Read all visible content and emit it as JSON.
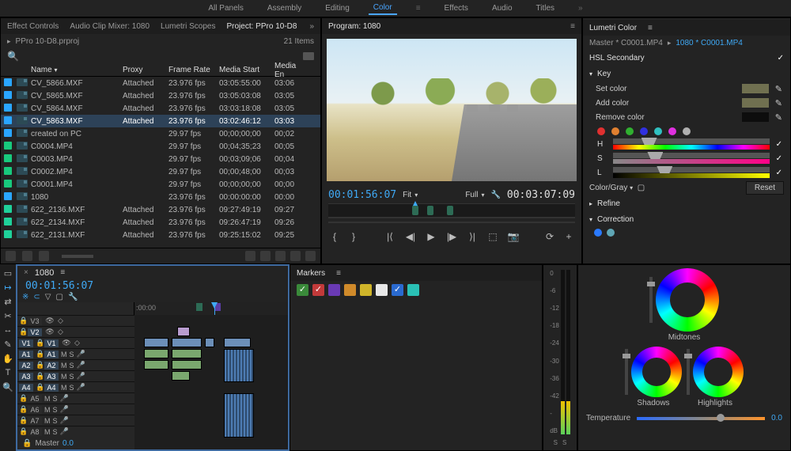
{
  "workspaces": {
    "w1": "All Panels",
    "w2": "Assembly",
    "w3": "Editing",
    "w4": "Color",
    "w5": "Effects",
    "w6": "Audio",
    "w7": "Titles"
  },
  "project_tabs": {
    "t1": "Effect Controls",
    "t2": "Audio Clip Mixer: 1080",
    "t3": "Lumetri Scopes",
    "t4": "Project: PPro 10-D8"
  },
  "project": {
    "path_file": "PPro 10-D8.prproj",
    "items_count": "21 Items",
    "headers": {
      "name": "Name",
      "proxy": "Proxy",
      "frame": "Frame Rate",
      "start": "Media Start",
      "end": "Media En"
    },
    "rows": [
      {
        "chip": "chipc1",
        "name": "CV_5866.MXF",
        "proxy": "Attached",
        "fr": "23.976 fps",
        "start": "03:05:55:00",
        "end": "03:06"
      },
      {
        "chip": "chipc1",
        "name": "CV_5865.MXF",
        "proxy": "Attached",
        "fr": "23.976 fps",
        "start": "03:05:03:08",
        "end": "03:05"
      },
      {
        "chip": "chipc1",
        "name": "CV_5864.MXF",
        "proxy": "Attached",
        "fr": "23.976 fps",
        "start": "03:03:18:08",
        "end": "03:05"
      },
      {
        "chip": "chipc1",
        "name": "CV_5863.MXF",
        "proxy": "Attached",
        "fr": "23.976 fps",
        "start": "03:02:46:12",
        "end": "03:03",
        "sel": true
      },
      {
        "chip": "chipc1",
        "name": "created on PC",
        "proxy": "",
        "fr": "29.97 fps",
        "start": "00;00;00;00",
        "end": "00;02"
      },
      {
        "chip": "chipc2",
        "name": "C0004.MP4",
        "proxy": "",
        "fr": "29.97 fps",
        "start": "00;04;35;23",
        "end": "00;05"
      },
      {
        "chip": "chipc2",
        "name": "C0003.MP4",
        "proxy": "",
        "fr": "29.97 fps",
        "start": "00;03;09;06",
        "end": "00;04"
      },
      {
        "chip": "chipc2",
        "name": "C0002.MP4",
        "proxy": "",
        "fr": "29.97 fps",
        "start": "00;00;48;00",
        "end": "00;03"
      },
      {
        "chip": "chipc2",
        "name": "C0001.MP4",
        "proxy": "",
        "fr": "29.97 fps",
        "start": "00;00;00;00",
        "end": "00;00"
      },
      {
        "chip": "chipc1",
        "name": "1080",
        "proxy": "",
        "fr": "23.976 fps",
        "start": "00:00:00:00",
        "end": "00:00"
      },
      {
        "chip": "chipc3",
        "name": "622_2136.MXF",
        "proxy": "Attached",
        "fr": "23.976 fps",
        "start": "09:27:49:19",
        "end": "09:27"
      },
      {
        "chip": "chipc3",
        "name": "622_2134.MXF",
        "proxy": "Attached",
        "fr": "23.976 fps",
        "start": "09:26:47:19",
        "end": "09:26"
      },
      {
        "chip": "chipc3",
        "name": "622_2131.MXF",
        "proxy": "Attached",
        "fr": "23.976 fps",
        "start": "09:25:15:02",
        "end": "09:25"
      }
    ]
  },
  "program": {
    "tab": "Program: 1080",
    "tc_in": "00:01:56:07",
    "fit": "Fit",
    "full": "Full",
    "tc_out": "00:03:07:09"
  },
  "lumetri": {
    "tab": "Lumetri Color",
    "master": "Master * C0001.MP4",
    "clip": "1080 * C0001.MP4",
    "hsl": "HSL Secondary",
    "key": "Key",
    "set": "Set color",
    "add": "Add color",
    "remove": "Remove color",
    "h": "H",
    "s": "S",
    "l": "L",
    "colorgray": "Color/Gray",
    "reset": "Reset",
    "refine": "Refine",
    "correction": "Correction",
    "midtones": "Midtones",
    "shadows": "Shadows",
    "highlights": "Highlights",
    "temperature": "Temperature",
    "temp_val": "0.0"
  },
  "timeline": {
    "sequence": "1080",
    "tc": "00:01:56:07",
    "ruler0": ":00:00",
    "master": "Master",
    "master_val": "0.0",
    "tracks": {
      "v3": "V3",
      "v2": "V2",
      "v1": "V1",
      "v1l": "V1",
      "a1": "A1",
      "a1l": "A1",
      "a2": "A2",
      "a2l": "A2",
      "a3": "A3",
      "a3l": "A3",
      "a4": "A4",
      "a4l": "A4",
      "a5": "A5",
      "a6": "A6",
      "a7": "A7",
      "a8": "A8"
    },
    "ms": {
      "m": "M",
      "s": "S"
    }
  },
  "markers": {
    "tab": "Markers"
  },
  "meter": {
    "ticks": [
      "0",
      "-6",
      "-12",
      "-18",
      "-24",
      "-30",
      "-36",
      "-42",
      "-",
      "dB"
    ],
    "s": "S",
    "s2": "S"
  }
}
